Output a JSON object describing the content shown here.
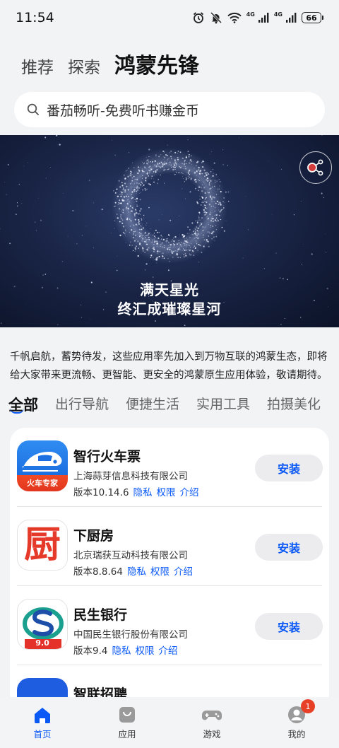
{
  "status_bar": {
    "time": "11:54",
    "battery": "66",
    "network_1": "4G",
    "network_2": "4G"
  },
  "top_tabs": [
    {
      "label": "推荐",
      "active": false
    },
    {
      "label": "探索",
      "active": false
    },
    {
      "label": "鸿蒙先锋",
      "active": true
    }
  ],
  "search": {
    "placeholder": "番茄畅听-免费听书赚金币"
  },
  "banner": {
    "line1": "满天星光",
    "line2": "终汇成璀璨星河"
  },
  "description": "千帆启航，蓄势待发，这些应用率先加入到万物互联的鸿蒙生态，即将给大家带来更流畅、更智能、更安全的鸿蒙原生应用体验，敬请期待。",
  "categories": [
    {
      "label": "全部",
      "active": true
    },
    {
      "label": "出行导航",
      "active": false
    },
    {
      "label": "便捷生活",
      "active": false
    },
    {
      "label": "实用工具",
      "active": false
    },
    {
      "label": "拍摄美化",
      "active": false
    }
  ],
  "apps": [
    {
      "name": "智行火车票",
      "company": "上海蒜芽信息科技有限公司",
      "version": "版本10.14.6",
      "privacy": "隐私",
      "permissions": "权限",
      "intro": "介绍",
      "install": "安装",
      "icon": "train-icon",
      "icon_text": "火车专家"
    },
    {
      "name": "下厨房",
      "company": "北京瑞获互动科技有限公司",
      "version": "版本8.8.64",
      "privacy": "隐私",
      "permissions": "权限",
      "intro": "介绍",
      "install": "安装",
      "icon": "kitchen-icon",
      "icon_text": "厨"
    },
    {
      "name": "民生银行",
      "company": "中国民生银行股份有限公司",
      "version": "版本9.4",
      "privacy": "隐私",
      "permissions": "权限",
      "intro": "介绍",
      "install": "安装",
      "icon": "bank-icon",
      "icon_text": "9.0"
    },
    {
      "name": "智联招聘",
      "company": "",
      "version": "",
      "privacy": "",
      "permissions": "",
      "intro": "",
      "install": "",
      "icon": "recruit-icon",
      "icon_text": ""
    }
  ],
  "bottom_nav": [
    {
      "label": "首页",
      "icon": "home-icon",
      "active": true
    },
    {
      "label": "应用",
      "icon": "apps-bag-icon",
      "active": false
    },
    {
      "label": "游戏",
      "icon": "gamepad-icon",
      "active": false
    },
    {
      "label": "我的",
      "icon": "profile-icon",
      "active": false,
      "badge": "1"
    }
  ],
  "colors": {
    "accent": "#0a59f7",
    "badge": "#e84026",
    "background": "#f1f3f5"
  }
}
